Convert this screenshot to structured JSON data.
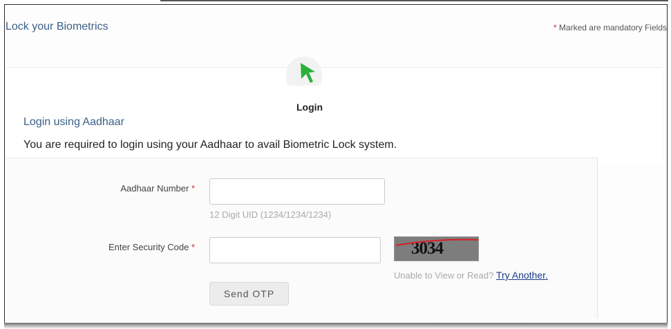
{
  "header": {
    "title": "Lock your Biometrics",
    "mandatory_star": "*",
    "mandatory_text": "Marked are mandatory Fields"
  },
  "step": {
    "icon": "cursor-arrow-icon",
    "label": "Login"
  },
  "section": {
    "title": "Login using Aadhaar",
    "instruction": "You are required to login using your Aadhaar to avail Biometric Lock system."
  },
  "form": {
    "aadhaar_label": "Aadhaar Number",
    "aadhaar_star": "*",
    "aadhaar_value": "",
    "aadhaar_hint": "12 Digit UID (1234/1234/1234)",
    "code_label": "Enter Security Code",
    "code_star": "*",
    "code_value": "",
    "captcha_text": "3034",
    "unable_text": "Unable to View or Read?",
    "try_another": "Try Another.",
    "send_otp": "Send OTP"
  },
  "colors": {
    "title_blue": "#3a5f86",
    "required_red": "#d9272e",
    "link_blue": "#1a3a8c",
    "cursor_green": "#2bb13a"
  }
}
